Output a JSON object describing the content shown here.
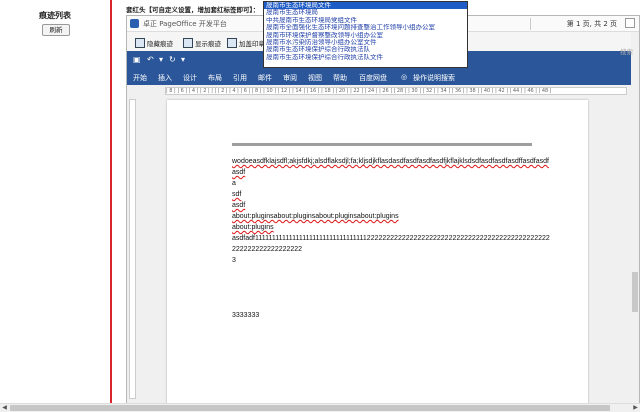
{
  "left_panel": {
    "title": "痕迹列表",
    "refresh_label": "刷新"
  },
  "header": {
    "label": "套红头【可自定义设置，增加套红标签即可】："
  },
  "template_select": {
    "selected_index": 0,
    "options": [
      "晟南市生态环境局文件",
      "晟南市生态环境局",
      "中共晟南市生态环境局党组文件",
      "晟南市全面强化生态环境问题排查整治工作领导小组办公室",
      "晟南市环境保护督察整改领导小组办公室",
      "晟南市水污染防治领导小组办公室文件",
      "晟南市生态环境保护综合行政执法队",
      "晟南市生态环境保护综合行政执法队文件"
    ]
  },
  "viewer": {
    "app_title": "卓正 PageOffice 开发平台",
    "page_info": "第 1 页, 共 2 页",
    "toolbar": {
      "hide_marks": "隐藏痕迹",
      "show_marks": "显示痕迹",
      "add_seal": "加盖印章"
    },
    "search_label": "搜索",
    "ribbon_tabs": [
      "开始",
      "插入",
      "设计",
      "布局",
      "引用",
      "邮件",
      "审阅",
      "视图",
      "帮助",
      "百度网盘",
      "操作说明搜索"
    ],
    "ruler_marks": "| 8 |  | 6 |  | 4 |  | 2 |  |  |  | 2 |  | 4 |  | 6 |  | 8 |  | 10 |  | 12 |  | 14 |  | 16 |  | 18 |  | 20 |  | 22 |  | 24 |  | 26 |  | 28 |  | 30 |  | 32 |  | 34 |  | 36 |  | 38 |  | 40 |  | 42 |  | 44 |  | 46 |  | 48 |"
  },
  "document": {
    "lines": [
      "wodoeasdfklajsdfl;akjsfdkj;alsdflaksdjl;fa;kljsdjkflasdasdfasdfasdfasdfjkflajklsdsdfasdfasdfasdffasdfasdfasdf",
      "a",
      "sdf",
      "asdf",
      "about:pluginsabout:pluginsabout:pluginsabout:plugins",
      "about:plugins",
      "asdfadf11111111111111111111111111111111122222222222222222222222222222222222222222222222222222222222222222",
      "3",
      "3333333"
    ]
  }
}
